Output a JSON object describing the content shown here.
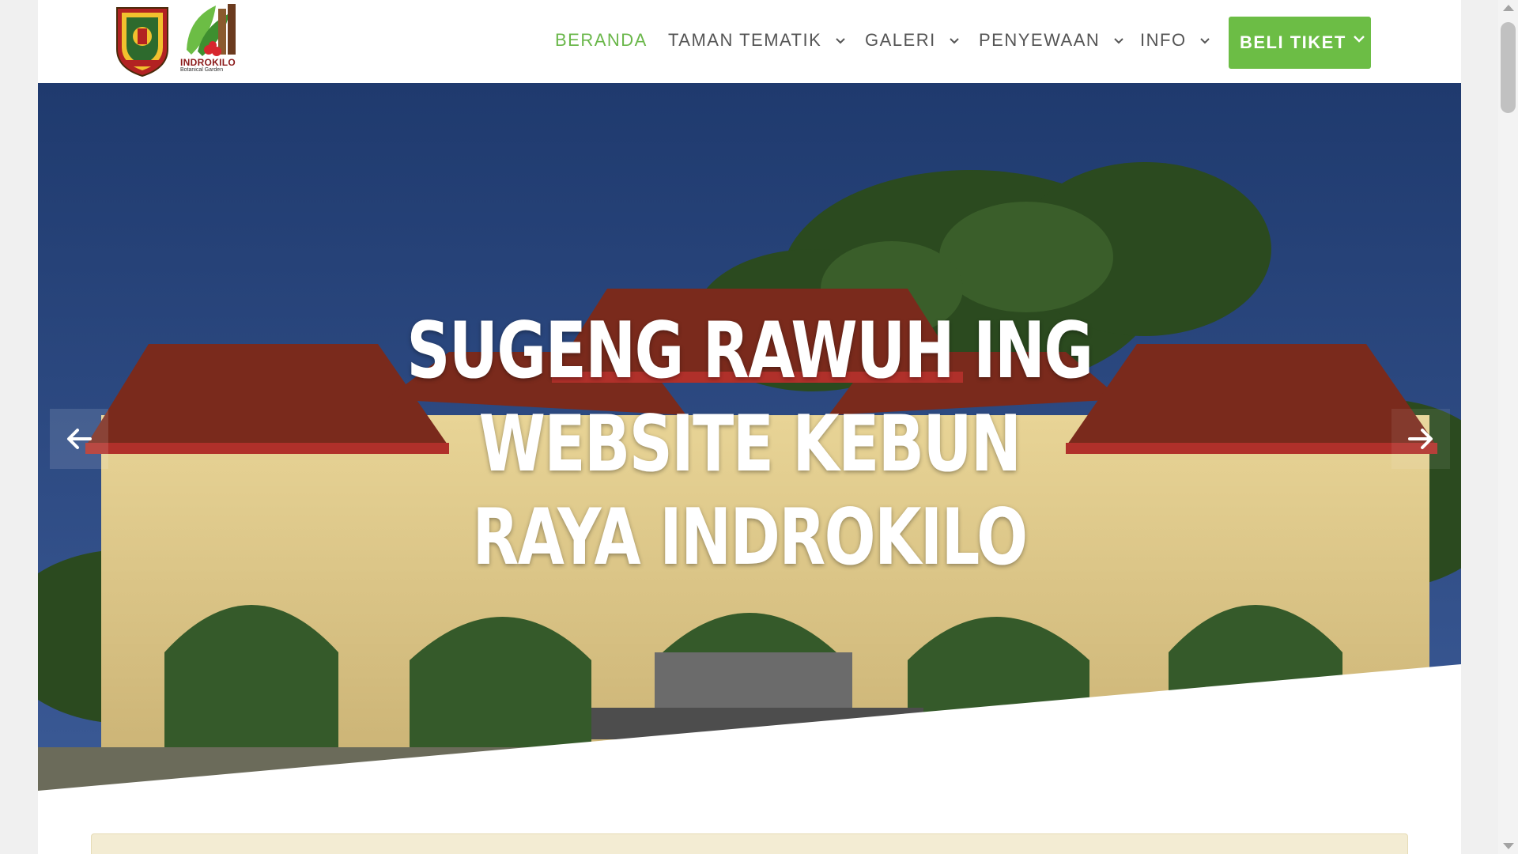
{
  "header": {
    "logo_text": "INDROKILO",
    "logo_sub": "Botanical Garden",
    "nav": [
      {
        "label": "BERANDA",
        "active": true,
        "has_dropdown": false
      },
      {
        "label": "TAMAN TEMATIK",
        "active": false,
        "has_dropdown": true
      },
      {
        "label": "GALERI",
        "active": false,
        "has_dropdown": true
      },
      {
        "label": "PENYEWAAN",
        "active": false,
        "has_dropdown": true
      },
      {
        "label": "INFO",
        "active": false,
        "has_dropdown": true
      }
    ],
    "cta_label": "BELI TIKET"
  },
  "hero": {
    "title_line1": "SUGENG RAWUH ING",
    "title_line2": "WEBSITE KEBUN",
    "title_line3": "RAYA INDROKILO",
    "prev_icon": "arrow-left-icon",
    "next_icon": "arrow-right-icon"
  },
  "colors": {
    "accent": "#6cbd45",
    "nav_active": "#6ab74a",
    "nav_text": "#555555",
    "sky": "#233f73",
    "notice_bg": "#f3ecd3"
  }
}
